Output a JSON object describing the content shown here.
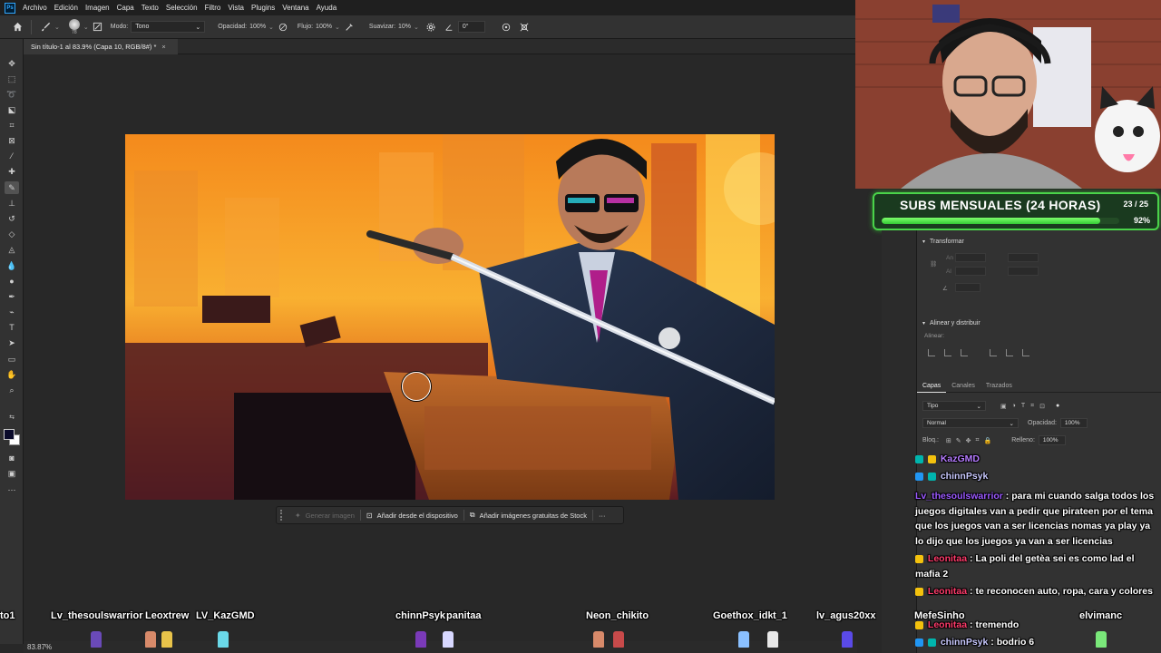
{
  "menubar": {
    "logo": "Ps",
    "items": [
      "Archivo",
      "Edición",
      "Imagen",
      "Capa",
      "Texto",
      "Selección",
      "Filtro",
      "Vista",
      "Plugins",
      "Ventana",
      "Ayuda"
    ]
  },
  "options": {
    "brush_size": "78",
    "mode_label": "Modo:",
    "mode_value": "Tono",
    "opacity_label": "Opacidad:",
    "opacity_value": "100%",
    "flow_label": "Flujo:",
    "flow_value": "100%",
    "smoothing_label": "Suavizar:",
    "smoothing_value": "10%",
    "angle_value": "0°"
  },
  "document": {
    "tab_title": "Sin título-1 al 83.9% (Capa 10, RGB/8#) *",
    "tab_close": "×"
  },
  "taskbar": {
    "generate": "Generar imagen",
    "add_device": "Añadir desde el dispositivo",
    "add_stock": "Añadir imágenes gratuitas de Stock",
    "more": "···"
  },
  "status": {
    "zoom": "83.87%"
  },
  "subs": {
    "title": "SUBS MENSUALES (24 HORAS)",
    "count": "23 / 25",
    "percent": "92%",
    "progress": 0.92
  },
  "panels": {
    "transform_title": "Transformar",
    "width_label": "An",
    "height_label": "Al",
    "align_title": "Alinear y distribuir",
    "align_label": "Alinear:",
    "tabs": [
      "Capas",
      "Canales",
      "Trazados"
    ],
    "filter_kind": "Tipo",
    "blend_mode": "Normal",
    "opacity_label": "Opacidad:",
    "opacity_value": "100%",
    "lock_label": "Bloq.:",
    "fill_label": "Relleno:",
    "fill_value": "100%"
  },
  "chat": [
    {
      "user": "KazGMD",
      "text": "",
      "color": "#b57bff"
    },
    {
      "user": "chinnPsyk",
      "text": "",
      "color": "#c9c9ff"
    },
    {
      "user": "Lv_thesoulswarrior",
      "text": "para mi cuando salga todos los juegos digitales van a pedir que pirateen por el tema que los juegos van a ser licencias nomas ya play ya lo dijo que los juegos ya van a ser licencias",
      "color": "#9b59ff"
    },
    {
      "user": "Leonitaa",
      "text": "La poli del getèa sei es como lad el mafia 2",
      "color": "#ff3b6b"
    },
    {
      "user": "Leonitaa",
      "text": "te reconocen auto, ropa, cara y colores",
      "color": "#ff3b6b"
    },
    {
      "user": "Leonitaa",
      "text": "tremendo",
      "color": "#ff3b6b"
    },
    {
      "user": "chinnPsyk",
      "text": "bodrio 6",
      "color": "#c9c9ff"
    }
  ],
  "viewers": [
    "to1",
    "Lv_thesoulswarrior",
    "Leoxtrew",
    "LV_KazGMD",
    "chinnPsyk",
    "panitaa",
    "Neon_chikito",
    "Goethox_idk",
    "t_1",
    "lv_agus20xx",
    "MefeSinho",
    "elvimanc"
  ],
  "icons": {
    "home": "home-icon",
    "brush": "brush-icon",
    "gear": "gear-icon"
  }
}
